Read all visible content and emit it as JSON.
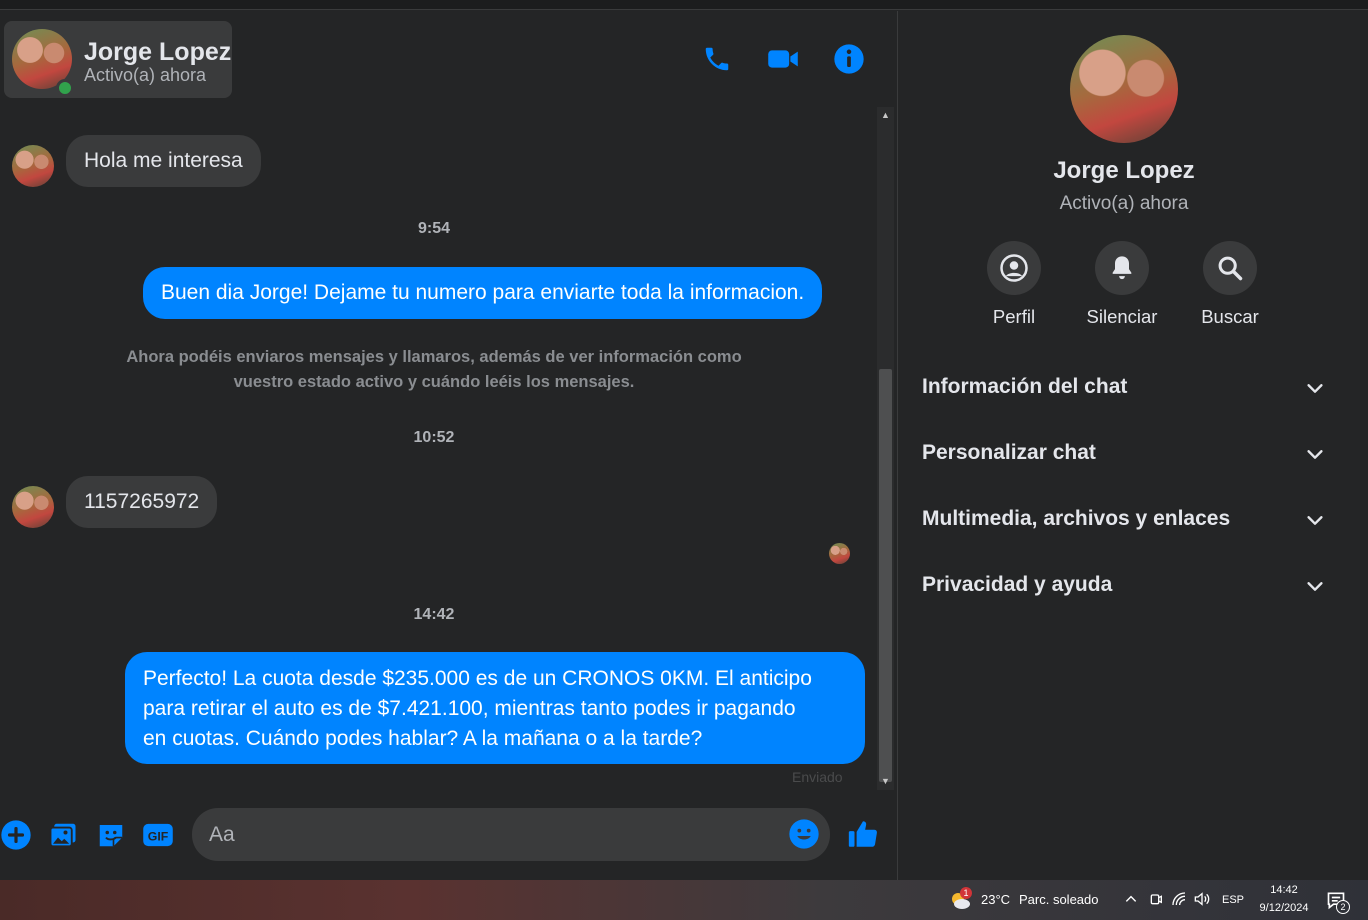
{
  "header": {
    "contact_name": "Jorge Lopez",
    "contact_status": "Activo(a) ahora",
    "icons": [
      "phone-icon",
      "video-camera-icon",
      "info-icon"
    ]
  },
  "messages": {
    "m1_text": "Hola  me interesa",
    "t1": "9:54",
    "m2_text": "Buen dia Jorge! Dejame tu numero para enviarte toda la informacion.",
    "system_note_line1": "Ahora podéis enviaros mensajes y llamaros, además de ver información como",
    "system_note_line2": "vuestro estado activo y cuándo leéis los mensajes.",
    "t2": "10:52",
    "m3_text": "1157265972",
    "t3": "14:42",
    "m4_line1": "Perfecto! La cuota desde $235.000 es de un CRONOS 0KM. El anticipo",
    "m4_line2": "para retirar el auto es de $7.421.100, mientras tanto podes ir pagando",
    "m4_line3": "en cuotas. Cuándo podes hablar? A la mañana o a la tarde?",
    "sent_status": "Enviado"
  },
  "composer": {
    "placeholder": "Aa",
    "icons": [
      "plus-icon",
      "gallery-icon",
      "sticker-icon",
      "gif-icon",
      "emoji-icon",
      "like-icon"
    ]
  },
  "side_panel": {
    "name": "Jorge Lopez",
    "status": "Activo(a) ahora",
    "actions": [
      {
        "label": "Perfil",
        "icon": "profile-icon"
      },
      {
        "label": "Silenciar",
        "icon": "bell-icon"
      },
      {
        "label": "Buscar",
        "icon": "search-icon"
      }
    ],
    "sections": [
      {
        "title": "Información del chat"
      },
      {
        "title": "Personalizar chat"
      },
      {
        "title": "Multimedia, archivos y enlaces"
      },
      {
        "title": "Privacidad y ayuda"
      }
    ]
  },
  "taskbar": {
    "weather_temp": "23°C",
    "weather_text": "Parc. soleado",
    "weather_badge": "1",
    "language": "ESP",
    "time": "14:42",
    "date": "9/12/2024",
    "notifications": "2"
  },
  "colors": {
    "accent": "#0084ff",
    "background": "#242526",
    "bubble_incoming": "#3a3b3c",
    "online": "#31a24c"
  }
}
